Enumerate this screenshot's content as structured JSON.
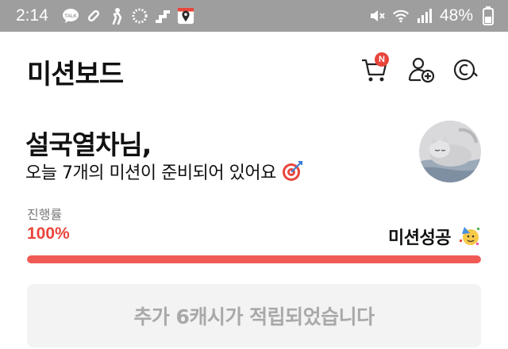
{
  "status_bar": {
    "time": "2:14",
    "battery_percent": "48%",
    "left_icons": [
      "talk-icon",
      "link-icon",
      "person-run-icon",
      "loading-icon",
      "steps-icon",
      "map-pin-icon"
    ],
    "right_icons": [
      "mute-icon",
      "wifi-icon",
      "signal-icon",
      "battery-icon"
    ]
  },
  "header": {
    "title": "미션보드",
    "cart_badge": "N"
  },
  "greeting": {
    "name": "설국열차님,",
    "subtitle": "오늘 7개의 미션이 준비되어 있어요"
  },
  "progress": {
    "label": "진행률",
    "value_text": "100%",
    "fraction": 1.0,
    "status": "미션성공"
  },
  "reward_button": {
    "label": "추가 6캐시가 적립되었습니다"
  },
  "colors": {
    "accent": "#f05a55",
    "status_bar": "#9e9e9e",
    "disabled_text": "#a9a9a9"
  }
}
